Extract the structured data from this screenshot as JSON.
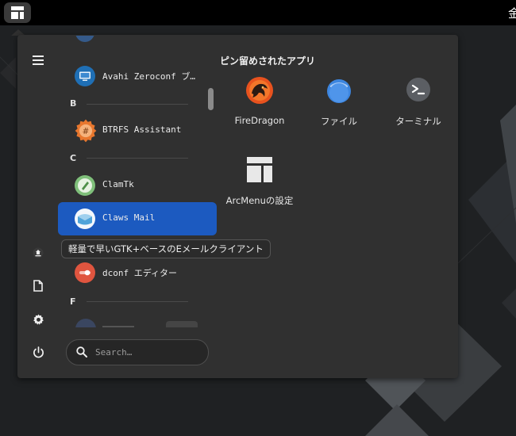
{
  "topbar": {
    "clock_glyph": "金"
  },
  "menu": {
    "categories": {
      "b": "B",
      "c": "C",
      "f": "F"
    },
    "apps": {
      "avahi": "Avahi Zeroconf ブ…",
      "btrfs": "BTRFS Assistant",
      "clamtk": "ClamTk",
      "claws": "Claws Mail",
      "dconf": "dconf エディター"
    },
    "tooltip": "軽量で早いGTK+ベースのEメールクライアント",
    "search": {
      "placeholder": "Search…"
    },
    "pinned": {
      "title": "ピン留めされたアプリ",
      "items": [
        {
          "label": "FireDragon",
          "icon": "firedragon-icon"
        },
        {
          "label": "ファイル",
          "icon": "files-icon"
        },
        {
          "label": "ターミナル",
          "icon": "terminal-icon"
        },
        {
          "label": "ArcMenuの設定",
          "icon": "arcmenu-settings-icon"
        }
      ]
    },
    "side_icons": [
      "hamburger-icon",
      "home-icon",
      "documents-icon",
      "settings-icon",
      "power-icon"
    ]
  },
  "colors": {
    "accent": "#1c5ac0",
    "menu_bg": "#303030",
    "topbar_bg": "#000000"
  }
}
